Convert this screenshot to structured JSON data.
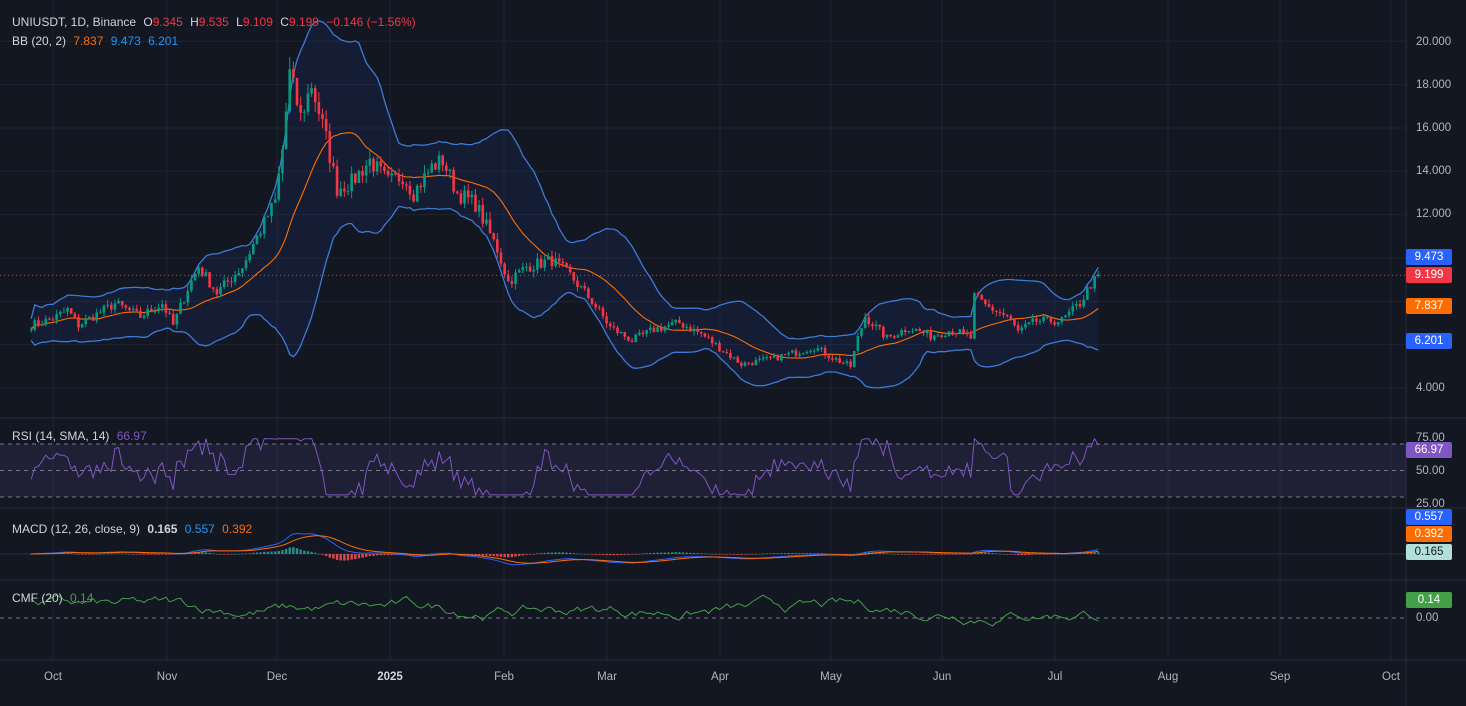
{
  "chart_data": {
    "type": "candlestick",
    "symbol": "UNIUSDT, 1D, Binance",
    "ohlc": {
      "o_label": "O",
      "o": "9.345",
      "h_label": "H",
      "h": "9.535",
      "l_label": "L",
      "l": "9.109",
      "c_label": "C",
      "c": "9.199",
      "change": "−0.146 (−1.56%)"
    },
    "bb": {
      "label": "BB (20, 2)",
      "basis": "7.837",
      "upper": "9.473",
      "lower": "6.201"
    },
    "rsi": {
      "label": "RSI (14, SMA, 14)",
      "value": "66.97",
      "levels": [
        75,
        50,
        25
      ]
    },
    "macd": {
      "label": "MACD (12, 26, close, 9)",
      "hist": "0.165",
      "macd": "0.557",
      "signal": "0.392"
    },
    "cmf": {
      "label": "CMF (20)",
      "value": "0.14"
    },
    "price_axis": [
      "20.000",
      "18.000",
      "16.000",
      "14.000",
      "12.000",
      "4.000"
    ],
    "rsi_axis": [
      "75.00",
      "50.00",
      "25.00"
    ],
    "cmf_axis": [
      "0.00"
    ],
    "time_axis": [
      "Oct",
      "Nov",
      "Dec",
      "2025",
      "Feb",
      "Mar",
      "Apr",
      "May",
      "Jun",
      "Jul",
      "Aug",
      "Sep",
      "Oct"
    ],
    "close_path": [
      [
        "2024-09-25",
        6.9
      ],
      [
        "2024-10-01",
        7.2
      ],
      [
        "2024-10-05",
        7.6
      ],
      [
        "2024-10-08",
        6.9
      ],
      [
        "2024-10-12",
        7.3
      ],
      [
        "2024-10-18",
        7.9
      ],
      [
        "2024-10-25",
        7.3
      ],
      [
        "2024-10-31",
        7.9
      ],
      [
        "2024-11-03",
        6.9
      ],
      [
        "2024-11-07",
        8.6
      ],
      [
        "2024-11-10",
        9.6
      ],
      [
        "2024-11-15",
        8.4
      ],
      [
        "2024-11-22",
        9.6
      ],
      [
        "2024-11-27",
        11.3
      ],
      [
        "2024-12-01",
        12.6
      ],
      [
        "2024-12-03",
        15.0
      ],
      [
        "2024-12-05",
        18.5
      ],
      [
        "2024-12-08",
        16.5
      ],
      [
        "2024-12-11",
        18.0
      ],
      [
        "2024-12-15",
        15.5
      ],
      [
        "2024-12-18",
        13.2
      ],
      [
        "2024-12-22",
        13.5
      ],
      [
        "2024-12-27",
        14.5
      ],
      [
        "2025-01-01",
        13.5
      ],
      [
        "2025-01-05",
        13.8
      ],
      [
        "2025-01-08",
        13.0
      ],
      [
        "2025-01-13",
        14.2
      ],
      [
        "2025-01-16",
        14.5
      ],
      [
        "2025-01-20",
        13.0
      ],
      [
        "2025-01-25",
        12.5
      ],
      [
        "2025-01-31",
        10.4
      ],
      [
        "2025-02-03",
        8.9
      ],
      [
        "2025-02-08",
        9.6
      ],
      [
        "2025-02-15",
        9.9
      ],
      [
        "2025-02-20",
        9.2
      ],
      [
        "2025-02-26",
        8.0
      ],
      [
        "2025-03-03",
        6.8
      ],
      [
        "2025-03-09",
        6.2
      ],
      [
        "2025-03-15",
        6.7
      ],
      [
        "2025-03-22",
        7.0
      ],
      [
        "2025-03-28",
        6.5
      ],
      [
        "2025-04-04",
        5.6
      ],
      [
        "2025-04-08",
        5.1
      ],
      [
        "2025-04-15",
        5.3
      ],
      [
        "2025-04-22",
        5.6
      ],
      [
        "2025-04-28",
        5.9
      ],
      [
        "2025-05-03",
        5.4
      ],
      [
        "2025-05-08",
        5.0
      ],
      [
        "2025-05-10",
        6.3
      ],
      [
        "2025-05-12",
        7.3
      ],
      [
        "2025-05-18",
        6.3
      ],
      [
        "2025-05-24",
        6.8
      ],
      [
        "2025-05-30",
        6.4
      ],
      [
        "2025-06-05",
        6.7
      ],
      [
        "2025-06-10",
        6.3
      ],
      [
        "2025-06-11",
        8.2
      ],
      [
        "2025-06-14",
        7.8
      ],
      [
        "2025-06-20",
        7.3
      ],
      [
        "2025-06-23",
        6.6
      ],
      [
        "2025-06-28",
        7.1
      ],
      [
        "2025-07-05",
        7.1
      ],
      [
        "2025-07-10",
        7.9
      ],
      [
        "2025-07-13",
        8.8
      ],
      [
        "2025-07-16",
        9.2
      ]
    ]
  },
  "colors": {
    "bg": "#131722",
    "grid": "#1f2330",
    "up": "#089981",
    "down": "#f23645",
    "basis": "#ff6d00",
    "bands": "#2962ff",
    "band_line": "#3d7ad8",
    "rsi": "#7e57c2",
    "macd": "#2962ff",
    "signal": "#ff6d00",
    "cmf": "#43a047"
  }
}
